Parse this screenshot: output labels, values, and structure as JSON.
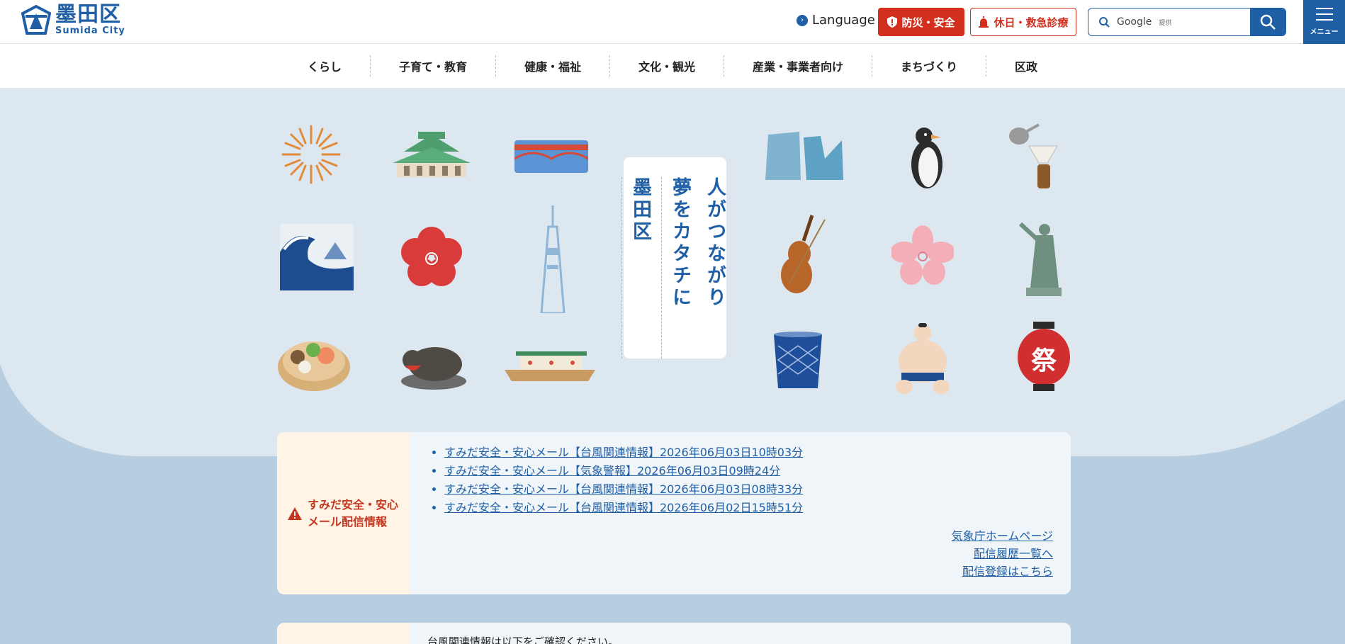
{
  "header": {
    "logo_jp": "墨田区",
    "logo_en": "Sumida City",
    "language_label": "Language",
    "safety_label": "防災・安全",
    "emergency_label": "休日・救急診療",
    "search_placeholder": "Google",
    "search_provider_note": "提供",
    "menu_label": "メニュー"
  },
  "nav": {
    "items": [
      "くらし",
      "子育て・教育",
      "健康・福祉",
      "文化・観光",
      "産業・事業者向け",
      "まちづくり",
      "区政"
    ]
  },
  "hero": {
    "catch_col1": "人がつながり",
    "catch_col2": "夢をカタチに",
    "catch_col3": "墨田区",
    "illustrations": [
      "fireworks-icon",
      "kokugikan-icon",
      "bridge-icon",
      "building-icon",
      "penguin-icon",
      "coffee-drip-icon",
      "wave-icon",
      "plum-flower-icon",
      "skytree-icon",
      "violin-icon",
      "cherry-blossom-icon",
      "statue-icon",
      "hotpot-icon",
      "bull-statue-icon",
      "yakatabune-icon",
      "kiriko-glass-icon",
      "sumo-wrestler-icon",
      "lantern-icon"
    ],
    "lantern_text": "祭"
  },
  "alert": {
    "label_line1": "すみだ安全・安心",
    "label_line2": "メール配信情報",
    "items": [
      "すみだ安全・安心メール【台風関連情報】2026年06月03日10時03分",
      "すみだ安全・安心メール【気象警報】2026年06月03日09時24分",
      "すみだ安全・安心メール【台風関連情報】2026年06月03日08時33分",
      "すみだ安全・安心メール【台風関連情報】2026年06月02日15時51分"
    ],
    "link_jma": "気象庁ホームページ",
    "link_history": "配信履歴一覧へ",
    "link_register": "配信登録はこちら"
  },
  "alert2": {
    "text": "台風関連情報は以下をご確認ください。"
  },
  "colors": {
    "brand_blue": "#1f5fa6",
    "alert_red": "#d22f1e",
    "hero_bg": "#dce7f0",
    "wave_bg": "#b7cde0"
  }
}
